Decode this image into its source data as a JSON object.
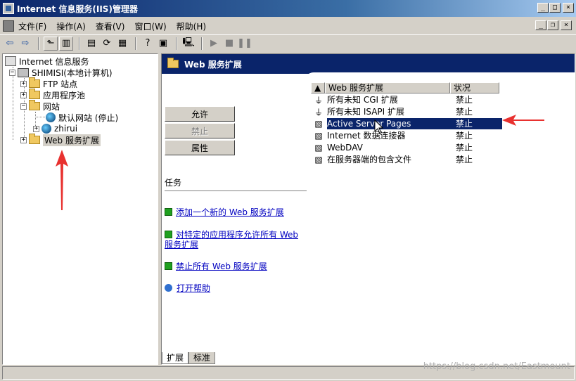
{
  "window": {
    "title": "Internet 信息服务(IIS)管理器"
  },
  "menu": [
    "文件(F)",
    "操作(A)",
    "查看(V)",
    "窗口(W)",
    "帮助(H)"
  ],
  "toolbar": [
    "back-icon",
    "forward-icon",
    "up-folder-icon",
    "show-tree-icon",
    "properties-icon",
    "refresh-icon",
    "export-icon",
    "help-icon",
    "console-icon",
    "computer-icon",
    "play-icon",
    "stop-icon",
    "pause-icon"
  ],
  "tree": {
    "root": "Internet 信息服务",
    "computer": "SHIMISI(本地计算机)",
    "ftp": "FTP 站点",
    "apppools": "应用程序池",
    "websites": "网站",
    "default_site": "默认网站 (停止)",
    "zhirui": "zhirui",
    "web_ext": "Web 服务扩展"
  },
  "header": {
    "title": "Web 服务扩展"
  },
  "buttons": {
    "allow": "允许",
    "prohibit": "禁止",
    "properties": "属性"
  },
  "tasks": {
    "title": "任务",
    "add_new": "添加一个新的 Web 服务扩展",
    "allow_all_l1": "对特定的应用程序允许所有 Web",
    "allow_all_l2": "服务扩展",
    "prohibit_all": "禁止所有 Web 服务扩展",
    "open_help": "打开帮助"
  },
  "list": {
    "col_name": "Web 服务扩展",
    "col_status": "状况",
    "rows": [
      {
        "icon": "filter-icon",
        "name": "所有未知 CGI 扩展",
        "status": "禁止"
      },
      {
        "icon": "filter-icon",
        "name": "所有未知 ISAPI 扩展",
        "status": "禁止"
      },
      {
        "icon": "extension-icon",
        "name": "Active Server Pages",
        "status": "禁止",
        "selected": true
      },
      {
        "icon": "extension-icon",
        "name": "Internet 数据连接器",
        "status": "禁止"
      },
      {
        "icon": "extension-icon",
        "name": "WebDAV",
        "status": "禁止"
      },
      {
        "icon": "extension-icon",
        "name": "在服务器端的包含文件",
        "status": "禁止"
      }
    ]
  },
  "tabs": [
    "扩展",
    "标准"
  ],
  "watermark": "https://blog.csdn.net/Eastmount",
  "colors": {
    "titlebar": "#0a246a",
    "selection": "#0a246a",
    "annotation": "#e8312f",
    "link": "#0000c0"
  }
}
